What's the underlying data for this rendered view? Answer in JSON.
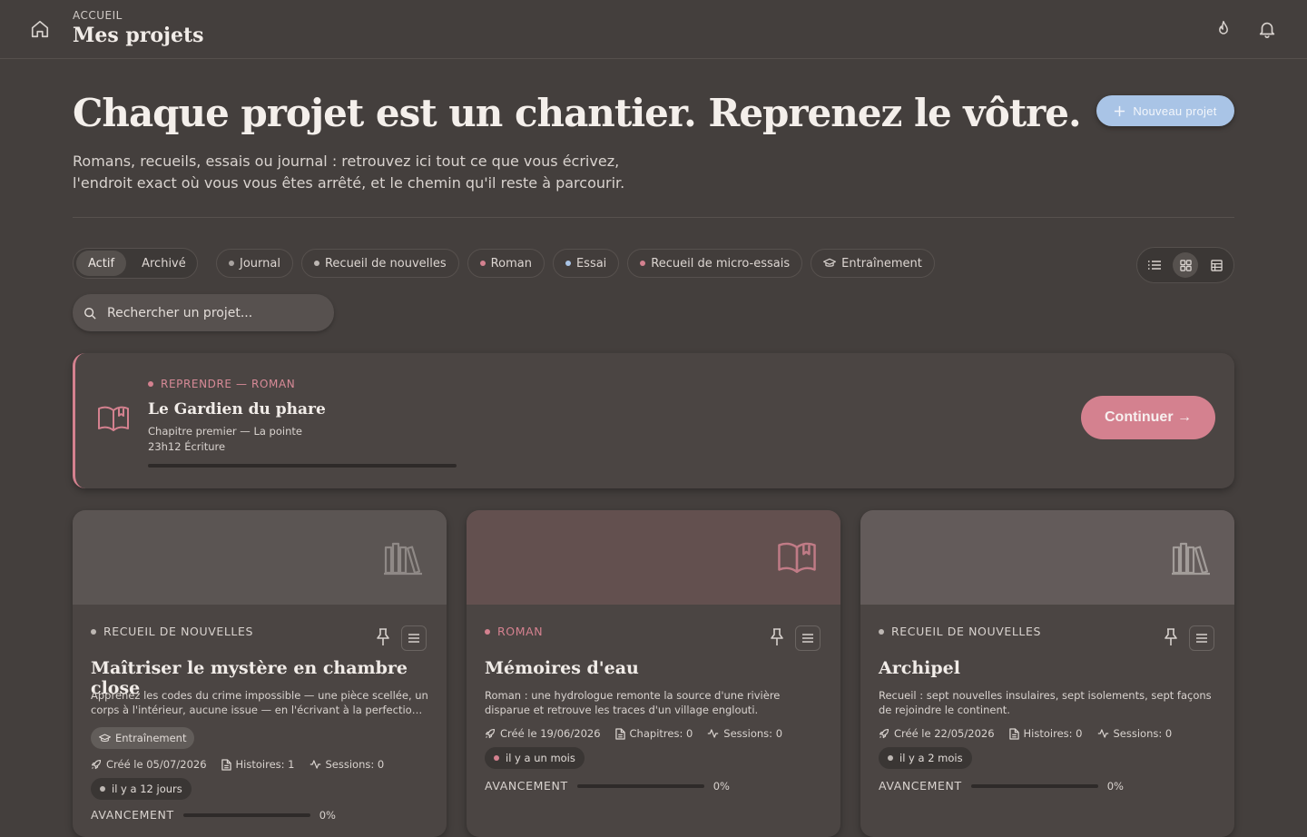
{
  "header": {
    "breadcrumb": "ACCUEIL",
    "title": "Mes projets",
    "icons": {
      "home": "home-icon",
      "streak": "flame-icon",
      "notifications": "bell-icon"
    }
  },
  "hero": {
    "title": "Chaque projet est un chantier. Reprenez le vôtre.",
    "subtitle_line1": "Romans, recueils, essais ou journal : retrouvez ici tout ce que vous écrivez,",
    "subtitle_line2": "l'endroit exact où vous vous êtes arrêté, et le chemin qu'il reste à parcourir.",
    "new_project_label": "Nouveau projet"
  },
  "filters": {
    "status": [
      {
        "label": "Actif",
        "active": true
      },
      {
        "label": "Archivé",
        "active": false
      }
    ],
    "genres": [
      {
        "label": "Journal",
        "color": "#a9a3a0",
        "icon": "dot"
      },
      {
        "label": "Recueil de nouvelles",
        "color": "#bdb7b3",
        "icon": "dot"
      },
      {
        "label": "Roman",
        "color": "#d4818f",
        "icon": "dot"
      },
      {
        "label": "Essai",
        "color": "#a9c4e6",
        "icon": "dot"
      },
      {
        "label": "Recueil de micro-essais",
        "color": "#d4818f",
        "icon": "dot"
      },
      {
        "label": "Entraînement",
        "color": "#d9d3cf",
        "icon": "graduation-cap-icon"
      }
    ],
    "views": [
      {
        "name": "list-view-icon",
        "active": false
      },
      {
        "name": "grid-view-icon",
        "active": true
      },
      {
        "name": "table-view-icon",
        "active": false
      }
    ]
  },
  "search": {
    "placeholder": "Rechercher un projet..."
  },
  "resume": {
    "kicker": "REPRENDRE — ROMAN",
    "title": "Le Gardien du phare",
    "chapter": "Chapitre premier — La pointe",
    "time": "23h12 Écriture",
    "progress": 0,
    "button": "Continuer →",
    "accent": "#d4818f"
  },
  "cards": [
    {
      "type": "RECUEIL DE NOUVELLES",
      "type_color": "#d9d3cf",
      "cover_color": "#5b5553",
      "cover_icon": "bookshelf-icon",
      "icon_color": "#8f8986",
      "title": "Maîtriser le mystère en chambre close",
      "description": "Apprenez les codes du crime impossible — une pièce scellée, un corps à l'intérieur, aucune issue — en l'écrivant à la perfection, u...",
      "tag": "Entraînement",
      "created": "Créé le 05/07/2026",
      "count": "Histoires: 1",
      "sessions": "Sessions: 0",
      "ago": "il y a 12 jours",
      "ago_dot": "#bdb7b3",
      "progress_label": "AVANCEMENT",
      "progress": 0,
      "progress_text": "0%"
    },
    {
      "type": "ROMAN",
      "type_color": "#d4818f",
      "cover_color": "#63504f",
      "cover_icon": "open-book-icon",
      "icon_color": "#c07b86",
      "title": "Mémoires d'eau",
      "description": "Roman : une hydrologue remonte la source d'une rivière disparue et retrouve les traces d'un village englouti.",
      "created": "Créé le 19/06/2026",
      "count": "Chapitres: 0",
      "sessions": "Sessions: 0",
      "ago": "il y a un mois",
      "ago_dot": "#d4818f",
      "progress_label": "AVANCEMENT",
      "progress": 0,
      "progress_text": "0%"
    },
    {
      "type": "RECUEIL DE NOUVELLES",
      "type_color": "#d9d3cf",
      "cover_color": "#635b5a",
      "cover_icon": "bookshelf-icon",
      "icon_color": "#a29c99",
      "title": "Archipel",
      "description": "Recueil : sept nouvelles insulaires, sept isolements, sept façons de rejoindre le continent.",
      "created": "Créé le 22/05/2026",
      "count": "Histoires: 0",
      "sessions": "Sessions: 0",
      "ago": "il y a 2 mois",
      "ago_dot": "#bdb7b3",
      "progress_label": "AVANCEMENT",
      "progress": 0,
      "progress_text": "0%"
    }
  ]
}
